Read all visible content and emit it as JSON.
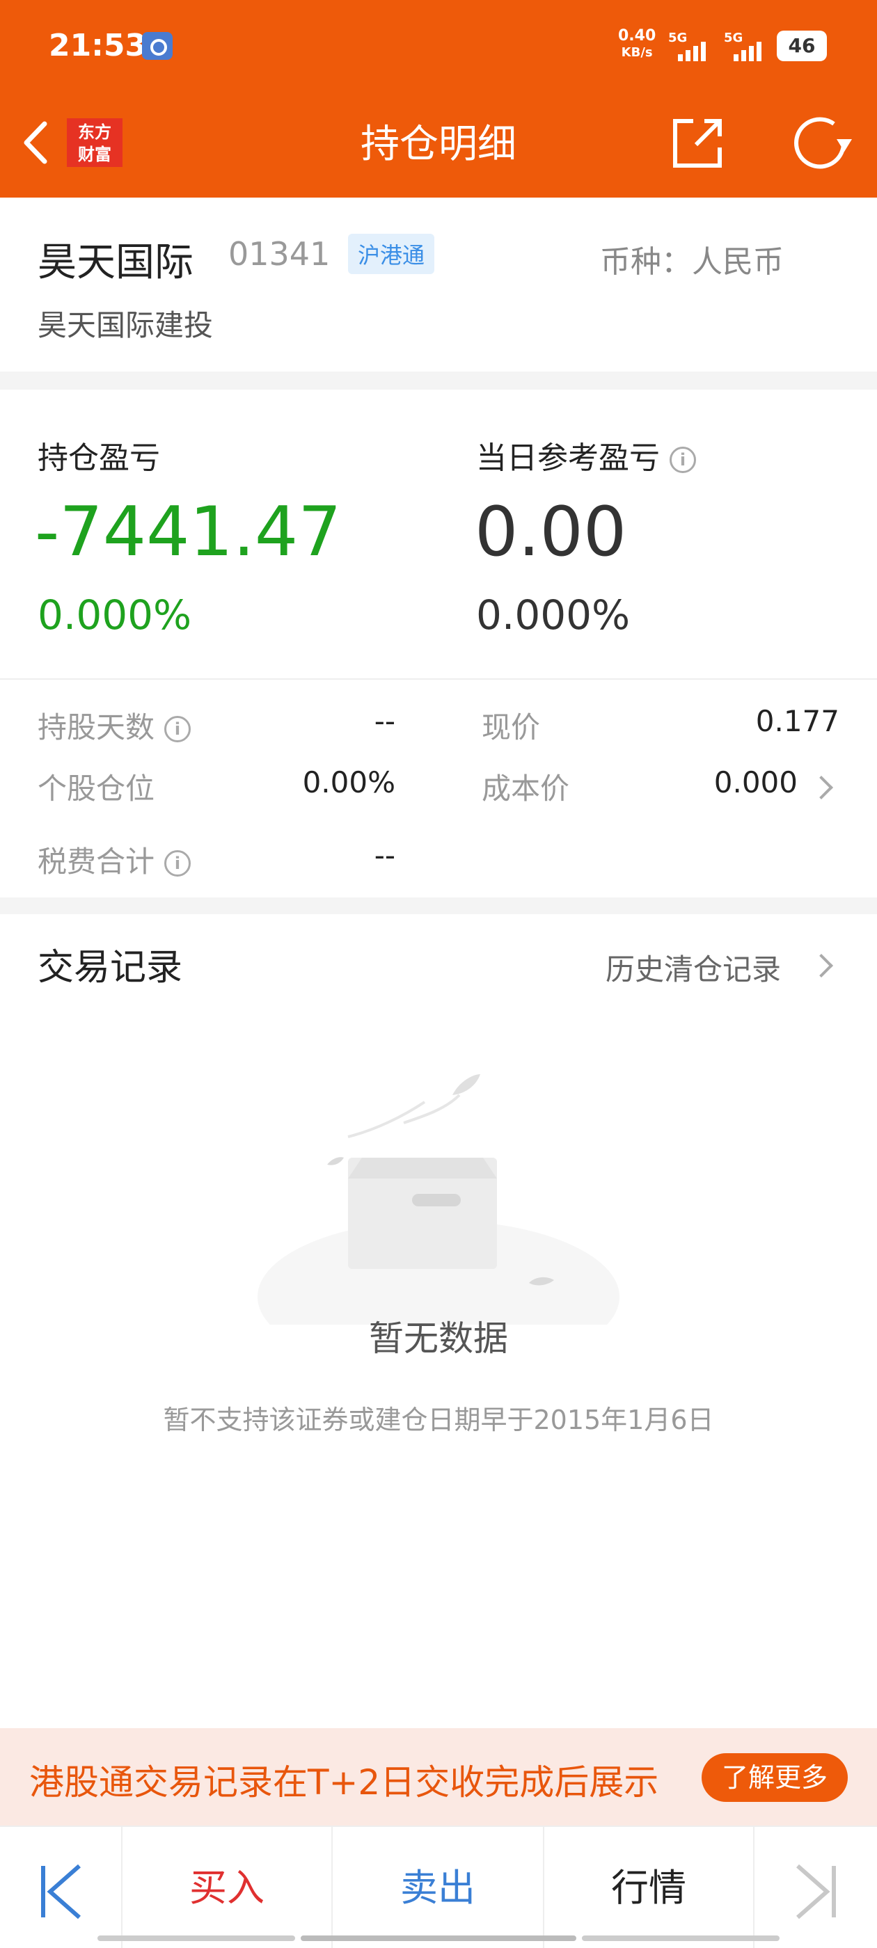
{
  "status_bar": {
    "time": "21:53",
    "net_speed_value": "0.40",
    "net_speed_unit": "KB/s",
    "sim1_label": "5G",
    "sim2_label": "5G",
    "battery": "46"
  },
  "header": {
    "title": "持仓明细",
    "logo_line1": "东方",
    "logo_line2": "财富",
    "icons": [
      "back-icon",
      "share-icon",
      "refresh-icon"
    ]
  },
  "stock": {
    "name": "昊天国际",
    "code": "01341",
    "tag": "沪港通",
    "currency": "币种：人民币",
    "full_name": "昊天国际建投"
  },
  "pl": {
    "holding_label": "持仓盈亏",
    "holding_value": "-7441.47",
    "holding_pct": "0.000%",
    "daily_label": "当日参考盈亏",
    "daily_value": "0.00",
    "daily_pct": "0.000%",
    "info_glyph": "i"
  },
  "details": {
    "days_label": "持股天数",
    "days_value": "--",
    "price_label": "现价",
    "price_value": "0.177",
    "position_label": "个股仓位",
    "position_value": "0.00%",
    "cost_label": "成本价",
    "cost_value": "0.000",
    "tax_label": "税费合计",
    "tax_value": "--"
  },
  "trades": {
    "title": "交易记录",
    "history_link": "历史清仓记录",
    "empty_title": "暂无数据",
    "empty_sub": "暂不支持该证券或建仓日期早于2015年1月6日"
  },
  "banner": {
    "text": "港股通交易记录在T+2日交收完成后展示",
    "button": "了解更多"
  },
  "bottom_bar": {
    "buy": "买入",
    "sell": "卖出",
    "quote": "行情"
  },
  "colors": {
    "brand_orange": "#EE5A0A",
    "loss_green": "#1EA21E",
    "buy_red": "#E03030",
    "sell_blue": "#3A7FD5"
  }
}
